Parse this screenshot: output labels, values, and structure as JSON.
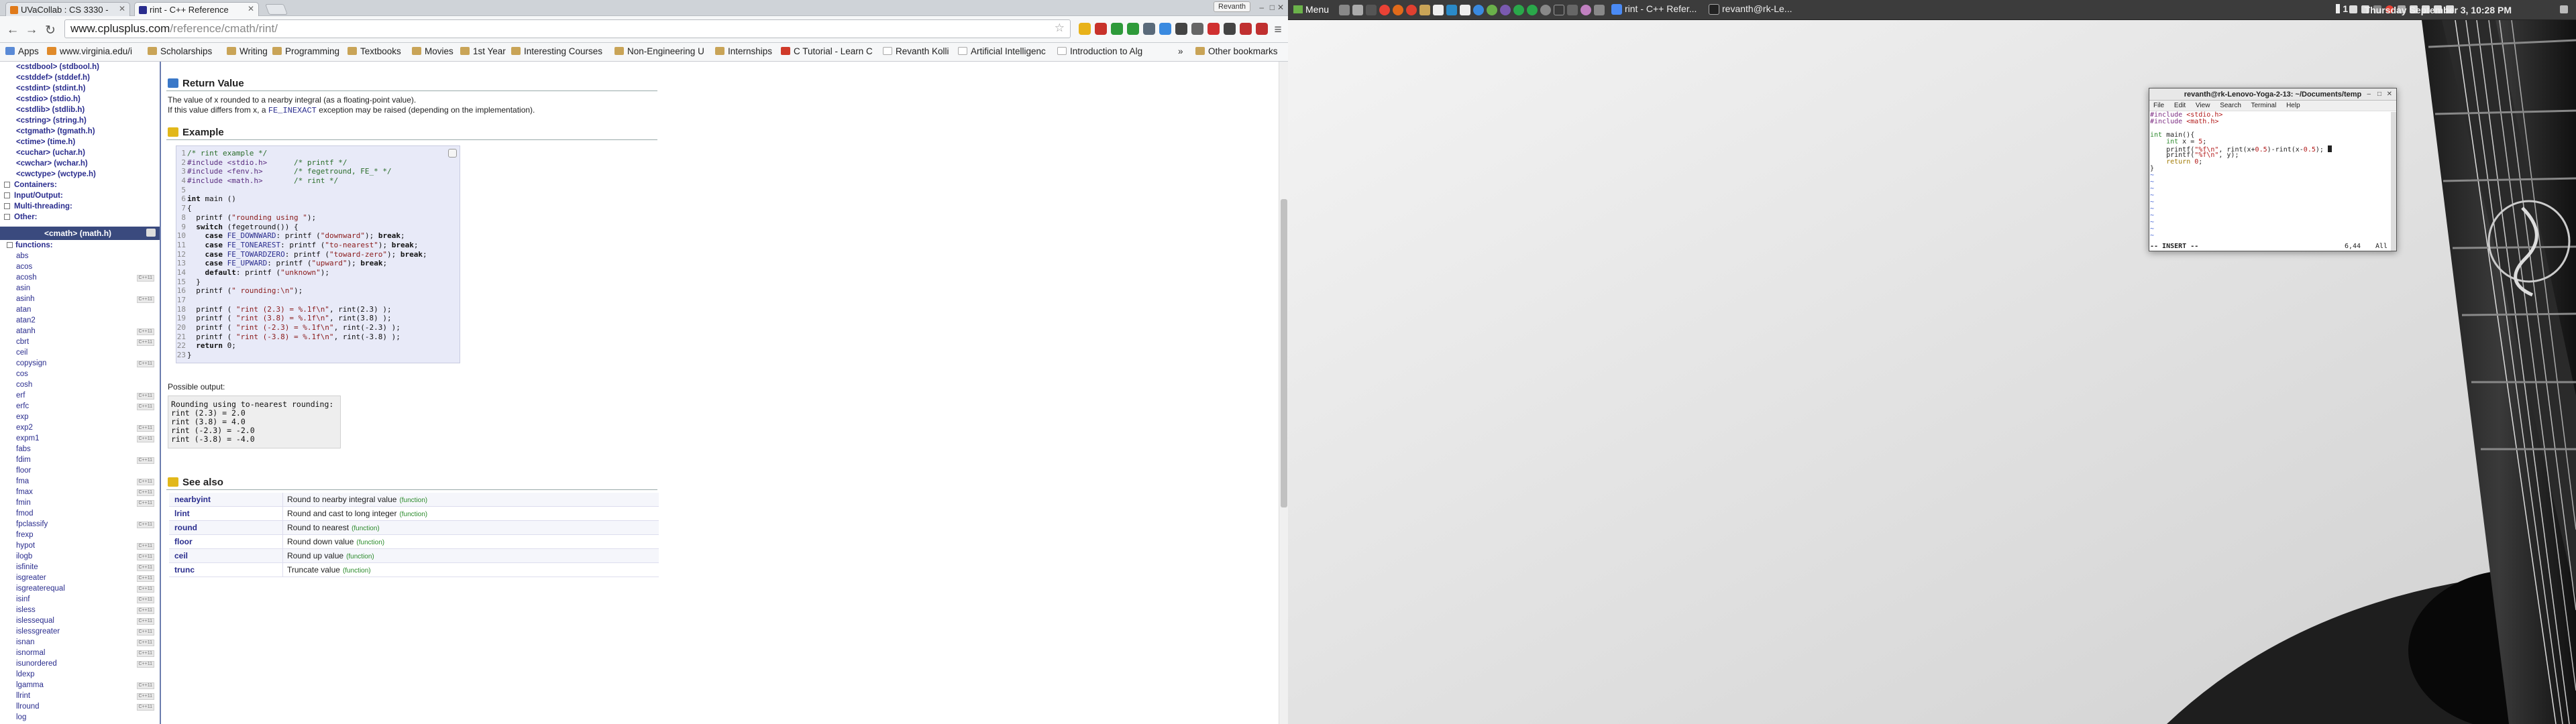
{
  "browser": {
    "tabs": [
      {
        "label": "UVaCollab : CS 3330 -",
        "fav_color": "#e07a1a"
      },
      {
        "label": "rint - C++ Reference",
        "fav_color": "#2a2d8e"
      }
    ],
    "profile": "Revanth",
    "url_host": "www.cplusplus.com",
    "url_path": "/reference/cmath/rint/",
    "bookmarks": [
      {
        "label": "Apps",
        "color": "#5a8ad6"
      },
      {
        "label": "www.virginia.edu/i",
        "color": "#e08a2a"
      },
      {
        "label": "Scholarships",
        "color": "#c9a457"
      },
      {
        "label": "Writing",
        "color": "#c9a457"
      },
      {
        "label": "Programming",
        "color": "#c9a457"
      },
      {
        "label": "Textbooks",
        "color": "#c9a457"
      },
      {
        "label": "Movies",
        "color": "#c9a457"
      },
      {
        "label": "1st Year",
        "color": "#c9a457"
      },
      {
        "label": "Interesting Courses",
        "color": "#c9a457"
      },
      {
        "label": "Non-Engineering U",
        "color": "#c9a457"
      },
      {
        "label": "Internships",
        "color": "#c9a457"
      },
      {
        "label": "C Tutorial - Learn C",
        "color": "#d03a2a"
      },
      {
        "label": "Revanth Kolli",
        "color": "#777777"
      },
      {
        "label": "Artificial Intelligenc",
        "color": "#777777"
      },
      {
        "label": "Introduction to Alg",
        "color": "#777777"
      },
      {
        "label": "Other bookmarks",
        "color": "#c9a457"
      }
    ],
    "bookmarks_more": "»"
  },
  "sidebar": {
    "headers": [
      "<cstdbool> (stdbool.h)",
      "<cstddef> (stddef.h)",
      "<cstdint> (stdint.h)",
      "<cstdio> (stdio.h)",
      "<cstdlib> (stdlib.h)",
      "<cstring> (string.h)",
      "<ctgmath> (tgmath.h)",
      "<ctime> (time.h)",
      "<cuchar> (uchar.h)",
      "<cwchar> (wchar.h)",
      "<cwctype> (wctype.h)"
    ],
    "sections": [
      "Containers:",
      "Input/Output:",
      "Multi-threading:",
      "Other:"
    ],
    "current_header": "<cmath> (math.h)",
    "functions_label": "functions:",
    "functions": [
      {
        "name": "abs",
        "tag": ""
      },
      {
        "name": "acos",
        "tag": ""
      },
      {
        "name": "acosh",
        "tag": "C++11"
      },
      {
        "name": "asin",
        "tag": ""
      },
      {
        "name": "asinh",
        "tag": "C++11"
      },
      {
        "name": "atan",
        "tag": ""
      },
      {
        "name": "atan2",
        "tag": ""
      },
      {
        "name": "atanh",
        "tag": "C++11"
      },
      {
        "name": "cbrt",
        "tag": "C++11"
      },
      {
        "name": "ceil",
        "tag": ""
      },
      {
        "name": "copysign",
        "tag": "C++11"
      },
      {
        "name": "cos",
        "tag": ""
      },
      {
        "name": "cosh",
        "tag": ""
      },
      {
        "name": "erf",
        "tag": "C++11"
      },
      {
        "name": "erfc",
        "tag": "C++11"
      },
      {
        "name": "exp",
        "tag": ""
      },
      {
        "name": "exp2",
        "tag": "C++11"
      },
      {
        "name": "expm1",
        "tag": "C++11"
      },
      {
        "name": "fabs",
        "tag": ""
      },
      {
        "name": "fdim",
        "tag": "C++11"
      },
      {
        "name": "floor",
        "tag": ""
      },
      {
        "name": "fma",
        "tag": "C++11"
      },
      {
        "name": "fmax",
        "tag": "C++11"
      },
      {
        "name": "fmin",
        "tag": "C++11"
      },
      {
        "name": "fmod",
        "tag": ""
      },
      {
        "name": "fpclassify",
        "tag": "C++11"
      },
      {
        "name": "frexp",
        "tag": ""
      },
      {
        "name": "hypot",
        "tag": "C++11"
      },
      {
        "name": "ilogb",
        "tag": "C++11"
      },
      {
        "name": "isfinite",
        "tag": "C++11"
      },
      {
        "name": "isgreater",
        "tag": "C++11"
      },
      {
        "name": "isgreaterequal",
        "tag": "C++11"
      },
      {
        "name": "isinf",
        "tag": "C++11"
      },
      {
        "name": "isless",
        "tag": "C++11"
      },
      {
        "name": "islessequal",
        "tag": "C++11"
      },
      {
        "name": "islessgreater",
        "tag": "C++11"
      },
      {
        "name": "isnan",
        "tag": "C++11"
      },
      {
        "name": "isnormal",
        "tag": "C++11"
      },
      {
        "name": "isunordered",
        "tag": "C++11"
      },
      {
        "name": "ldexp",
        "tag": ""
      },
      {
        "name": "lgamma",
        "tag": "C++11"
      },
      {
        "name": "llrint",
        "tag": "C++11"
      },
      {
        "name": "llround",
        "tag": "C++11"
      },
      {
        "name": "log",
        "tag": ""
      }
    ]
  },
  "content": {
    "return_title": "Return Value",
    "return_line1": "The value of x rounded to a nearby integral (as a floating-point value).",
    "return_line2_a": "If this value differs from x, a ",
    "return_line2_code": "FE_INEXACT",
    "return_line2_b": " exception may be raised (depending on the implementation).",
    "example_title": "Example",
    "output_label": "Possible output:",
    "output_text": "Rounding using to-nearest rounding:\nrint (2.3) = 2.0\nrint (3.8) = 4.0\nrint (-2.3) = -2.0\nrint (-3.8) = -4.0",
    "see_also_title": "See also",
    "see_also": [
      {
        "name": "nearbyint",
        "desc": "Round to nearby integral value",
        "kind": "(function)"
      },
      {
        "name": "lrint",
        "desc": "Round and cast to long integer",
        "kind": "(function)"
      },
      {
        "name": "round",
        "desc": "Round to nearest",
        "kind": "(function)"
      },
      {
        "name": "floor",
        "desc": "Round down value",
        "kind": "(function)"
      },
      {
        "name": "ceil",
        "desc": "Round up value",
        "kind": "(function)"
      },
      {
        "name": "trunc",
        "desc": "Truncate value",
        "kind": "(function)"
      }
    ]
  },
  "desktop": {
    "menu_label": "Menu",
    "taskbar": [
      {
        "label": "rint - C++ Refer...",
        "color": "#4a8af4"
      },
      {
        "label": "revanth@rk-Le...",
        "color": "#333333"
      }
    ],
    "tray_number": "1",
    "clock": "Thursday September  3, 10:28 PM"
  },
  "terminal": {
    "title": "revanth@rk-Lenovo-Yoga-2-13: ~/Documents/temp",
    "menu": [
      "File",
      "Edit",
      "View",
      "Search",
      "Terminal",
      "Help"
    ],
    "status_mode": "-- INSERT --",
    "status_pos": "6,44",
    "status_all": "All"
  }
}
